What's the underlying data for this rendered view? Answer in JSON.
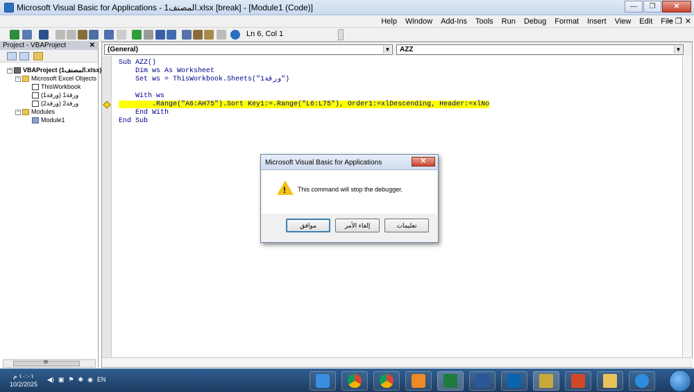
{
  "window": {
    "title": "Microsoft Visual Basic for Applications - المصنف1.xlsx [break] - [Module1 (Code)]",
    "controls": [
      "—",
      "❐",
      "✕"
    ]
  },
  "menu": {
    "items": [
      "Help",
      "Window",
      "Add-Ins",
      "Tools",
      "Run",
      "Debug",
      "Format",
      "Insert",
      "View",
      "Edit",
      "File"
    ],
    "ctrls": [
      "–",
      "❐",
      "✕"
    ]
  },
  "toolbar": {
    "position": "Ln 6, Col 1"
  },
  "project": {
    "title": "Project - VBAProject",
    "close": "✕",
    "tree": [
      {
        "label": "VBAProject (المصنف1.xlsx)",
        "kind": "vba",
        "bold": true
      },
      {
        "label": "Microsoft Excel Objects",
        "kind": "folder"
      },
      {
        "label": "ThisWorkbook",
        "kind": "sheet"
      },
      {
        "label": "ورقة1 (ورقة1)",
        "kind": "sheet"
      },
      {
        "label": "ورقة2 (ورقة2)",
        "kind": "sheet"
      },
      {
        "label": "Modules",
        "kind": "folder"
      },
      {
        "label": "Module1",
        "kind": "mod"
      }
    ],
    "scroll_mark": "III"
  },
  "code": {
    "object_combo": "(General)",
    "proc_combo": "AZZ",
    "lines": [
      "Sub AZZ()",
      "    Dim ws As Worksheet",
      "    Set ws = ThisWorkbook.Sheets(\"ورقة1\")",
      "",
      "    With ws",
      "        .Range(\"A6:AH75\").Sort Key1:=.Range(\"L6:L75\"), Order1:=xlDescending, Header:=xlNo",
      "    End With",
      "End Sub"
    ],
    "highlight_line": 5
  },
  "dialog": {
    "title": "Microsoft Visual Basic for Applications",
    "message": "This command will stop the debugger.",
    "buttons": [
      "تعليمات",
      "إلغاء الأمر",
      "موافق"
    ]
  },
  "taskbar": {
    "time": "١٠:٠١ م",
    "date": "10/2/2025",
    "lang": "EN",
    "apps": [
      "ie",
      "chrome",
      "chrome",
      "media",
      "excel",
      "word",
      "outlook",
      "vba",
      "powerpoint",
      "folder",
      "ie"
    ]
  },
  "colors": {
    "highlight": "#ffff00",
    "code_text": "#00008b",
    "titlebar": "#c9d9ee",
    "taskbar": "#1c3b61"
  }
}
